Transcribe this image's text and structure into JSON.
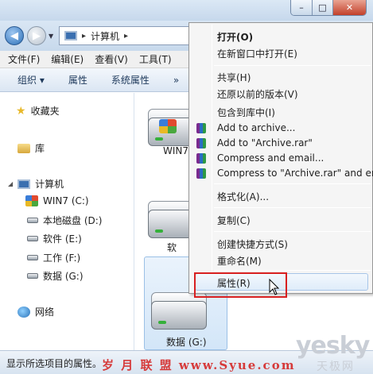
{
  "address": {
    "path_label": "计算机"
  },
  "menubar": [
    "文件(F)",
    "编辑(E)",
    "查看(V)",
    "工具(T)"
  ],
  "toolbar": [
    "组织 ▾",
    "属性",
    "系统属性",
    "»"
  ],
  "navpane": {
    "favorites": "收藏夹",
    "library": "库",
    "computer": "计算机",
    "drives": [
      "WIN7 (C:)",
      "本地磁盘 (D:)",
      "软件 (E:)",
      "工作 (F:)",
      "数据 (G:)"
    ],
    "network": "网络"
  },
  "content": {
    "tiles": [
      "WIN7",
      "软件",
      "数据 (G:)"
    ]
  },
  "context_menu": {
    "items": [
      "打开(O)",
      "在新窗口中打开(E)",
      "共享(H)",
      "还原以前的版本(V)",
      "包含到库中(I)",
      "Add to archive...",
      "Add to \"Archive.rar\"",
      "Compress and email...",
      "Compress to \"Archive.rar\" and em",
      "格式化(A)...",
      "复制(C)",
      "创建快捷方式(S)",
      "重命名(M)",
      "属性(R)"
    ]
  },
  "statusbar": {
    "text": "显示所选项目的属性。"
  },
  "watermark": {
    "left": "岁 月 联 盟   www.Syue.com",
    "brand": "yesky",
    "brand_cn": "天极网"
  }
}
